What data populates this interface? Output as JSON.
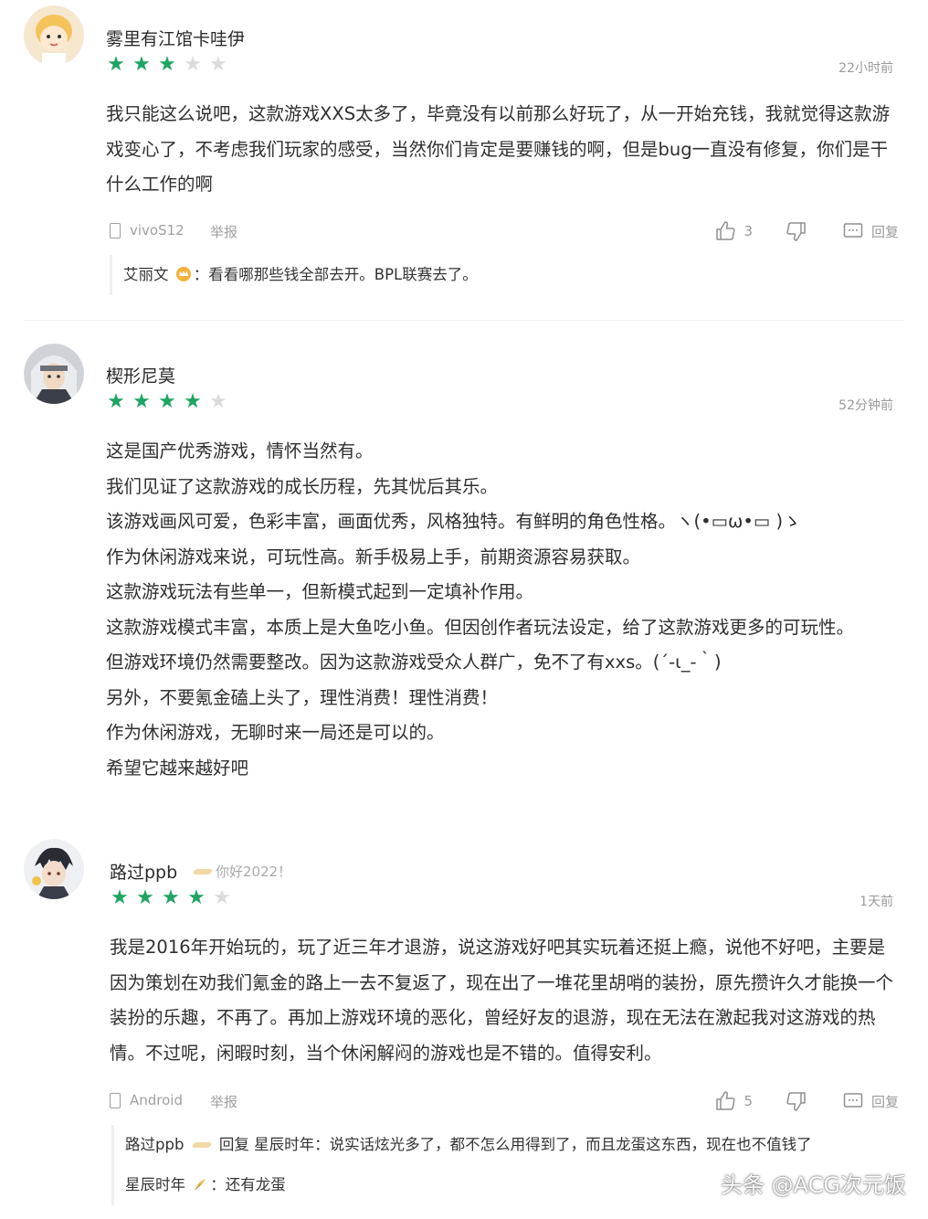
{
  "reviews": [
    {
      "username": "雾里有江馆卡哇伊",
      "rating": 3,
      "time": "22小时前",
      "paragraphs": [
        "我只能这么说吧，这款游戏XXS太多了，毕竟没有以前那么好玩了，从一开始充钱，我就觉得这款游戏变心了，不考虑我们玩家的感受，当然你们肯定是要赚钱的啊，但是bug一直没有修复，你们是干什么工作的啊"
      ],
      "device": "vivoS12",
      "report": "举报",
      "likes": "3",
      "reply_label": "回复",
      "replies": [
        {
          "author": "艾丽文",
          "text": "：看看哪那些钱全部去开。BPL联赛去了。"
        }
      ]
    },
    {
      "username": "楔形尼莫",
      "rating": 4,
      "time": "52分钟前",
      "paragraphs": [
        "这是国产优秀游戏，情怀当然有。",
        "我们见证了这款游戏的成长历程，先其忧后其乐。",
        "该游戏画风可爱，色彩丰富，画面优秀，风格独特。有鲜明的角色性格。ヽ(•▭ω•▭ )ゝ",
        "作为休闲游戏来说，可玩性高。新手极易上手，前期资源容易获取。",
        "这款游戏玩法有些单一，但新模式起到一定填补作用。",
        "这款游戏模式丰富，本质上是大鱼吃小鱼。但因创作者玩法设定，给了这款游戏更多的可玩性。",
        "但游戏环境仍然需要整改。因为这款游戏受众人群广，免不了有xxs。(´-ι_-｀)",
        "另外，不要氪金磕上头了，理性消费！理性消费！",
        "作为休闲游戏，无聊时来一局还是可以的。",
        "希望它越来越好吧"
      ]
    },
    {
      "username": "路过ppb",
      "badge": "你好2022！",
      "rating": 4,
      "time": "1天前",
      "paragraphs": [
        "我是2016年开始玩的，玩了近三年才退游，说这游戏好吧其实玩着还挺上瘾，说他不好吧，主要是因为策划在劝我们氪金的路上一去不复返了，现在出了一堆花里胡哨的装扮，原先攒许久才能换一个装扮的乐趣，不再了。再加上游戏环境的恶化，曾经好友的退游，现在无法在激起我对这游戏的热情。不过呢，闲暇时刻，当个休闲解闷的游戏也是不错的。值得安利。"
      ],
      "device": "Android",
      "report": "举报",
      "likes": "5",
      "reply_label": "回复",
      "replies": [
        {
          "author": "路过ppb",
          "mid": "回复",
          "target": "星辰时年",
          "text": "：说实话炫光多了，都不怎么用得到了，而且龙蛋这东西，现在也不值钱了"
        },
        {
          "author": "星辰时年",
          "text": "：还有龙蛋"
        }
      ]
    }
  ],
  "watermark": "头条 @ACG次元饭",
  "colors": {
    "star_on": "#1fa462",
    "star_off": "#dcdcdc",
    "text": "#2f2f2f",
    "muted": "#9a9a9a"
  }
}
